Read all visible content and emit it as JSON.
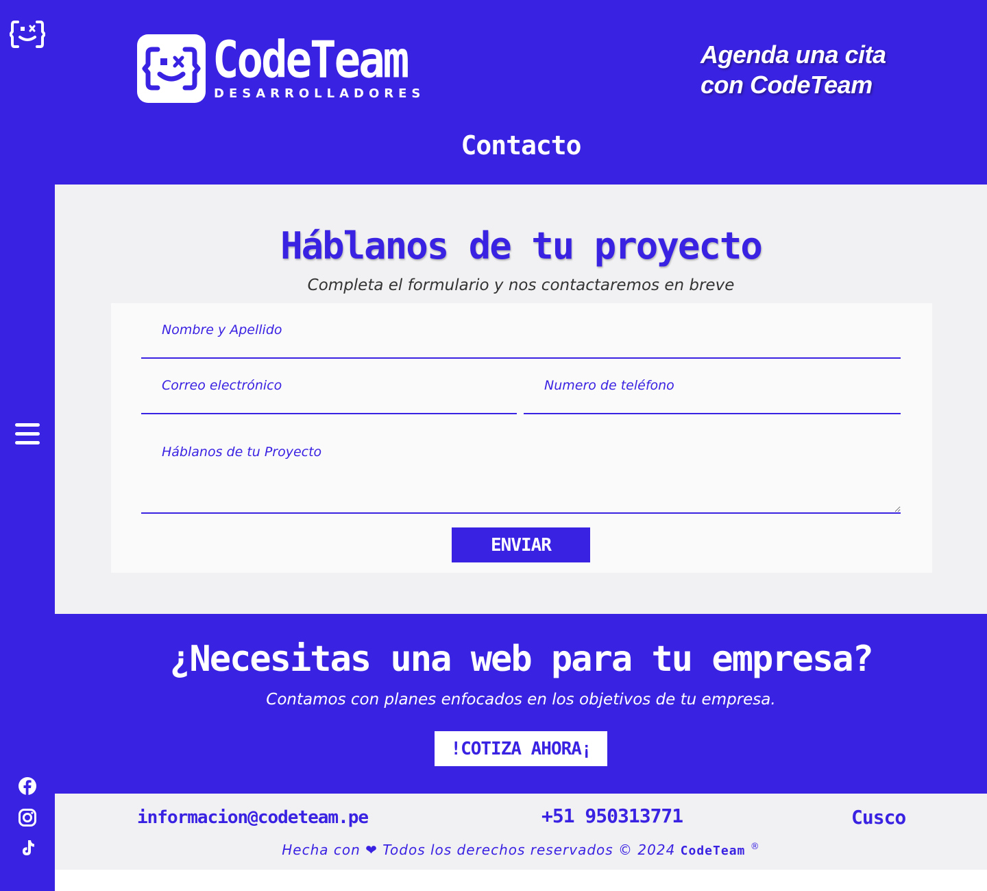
{
  "colors": {
    "brand": "#3a22e2",
    "light_bg": "#f1f1f3",
    "white": "#ffffff"
  },
  "sidebar": {
    "logo_icon": "codeteam-face-icon",
    "menu_icon": "hamburger-menu-icon",
    "social": [
      "facebook-icon",
      "instagram-icon",
      "tiktok-icon"
    ]
  },
  "header": {
    "brand_name": "CodeTeam",
    "brand_tagline": "DESARROLLADORES",
    "agenda_text": "Agenda una cita con CodeTeam",
    "page_title": "Contacto"
  },
  "contact_form": {
    "title": "Háblanos de tu proyecto",
    "subtitle": "Completa el formulario y nos contactaremos en breve",
    "name_placeholder": "Nombre y Apellido",
    "email_placeholder": "Correo electrónico",
    "phone_placeholder": "Numero de teléfono",
    "project_placeholder": "Háblanos de tu Proyecto",
    "submit_label": "ENVIAR"
  },
  "cta": {
    "title": "¿Necesitas una web para tu empresa?",
    "subtitle": "Contamos con planes enfocados en los objetivos de tu empresa.",
    "button_label": "!COTIZA AHORA¡"
  },
  "footer": {
    "email": "informacion@codeteam.pe",
    "phone": "+51 950313771",
    "city": "Cusco",
    "credits_prefix": "Hecha con",
    "credits_middle": "Todos los derechos reservados © 2024",
    "credits_brand": "CodeTeam",
    "credits_suffix": "®"
  }
}
